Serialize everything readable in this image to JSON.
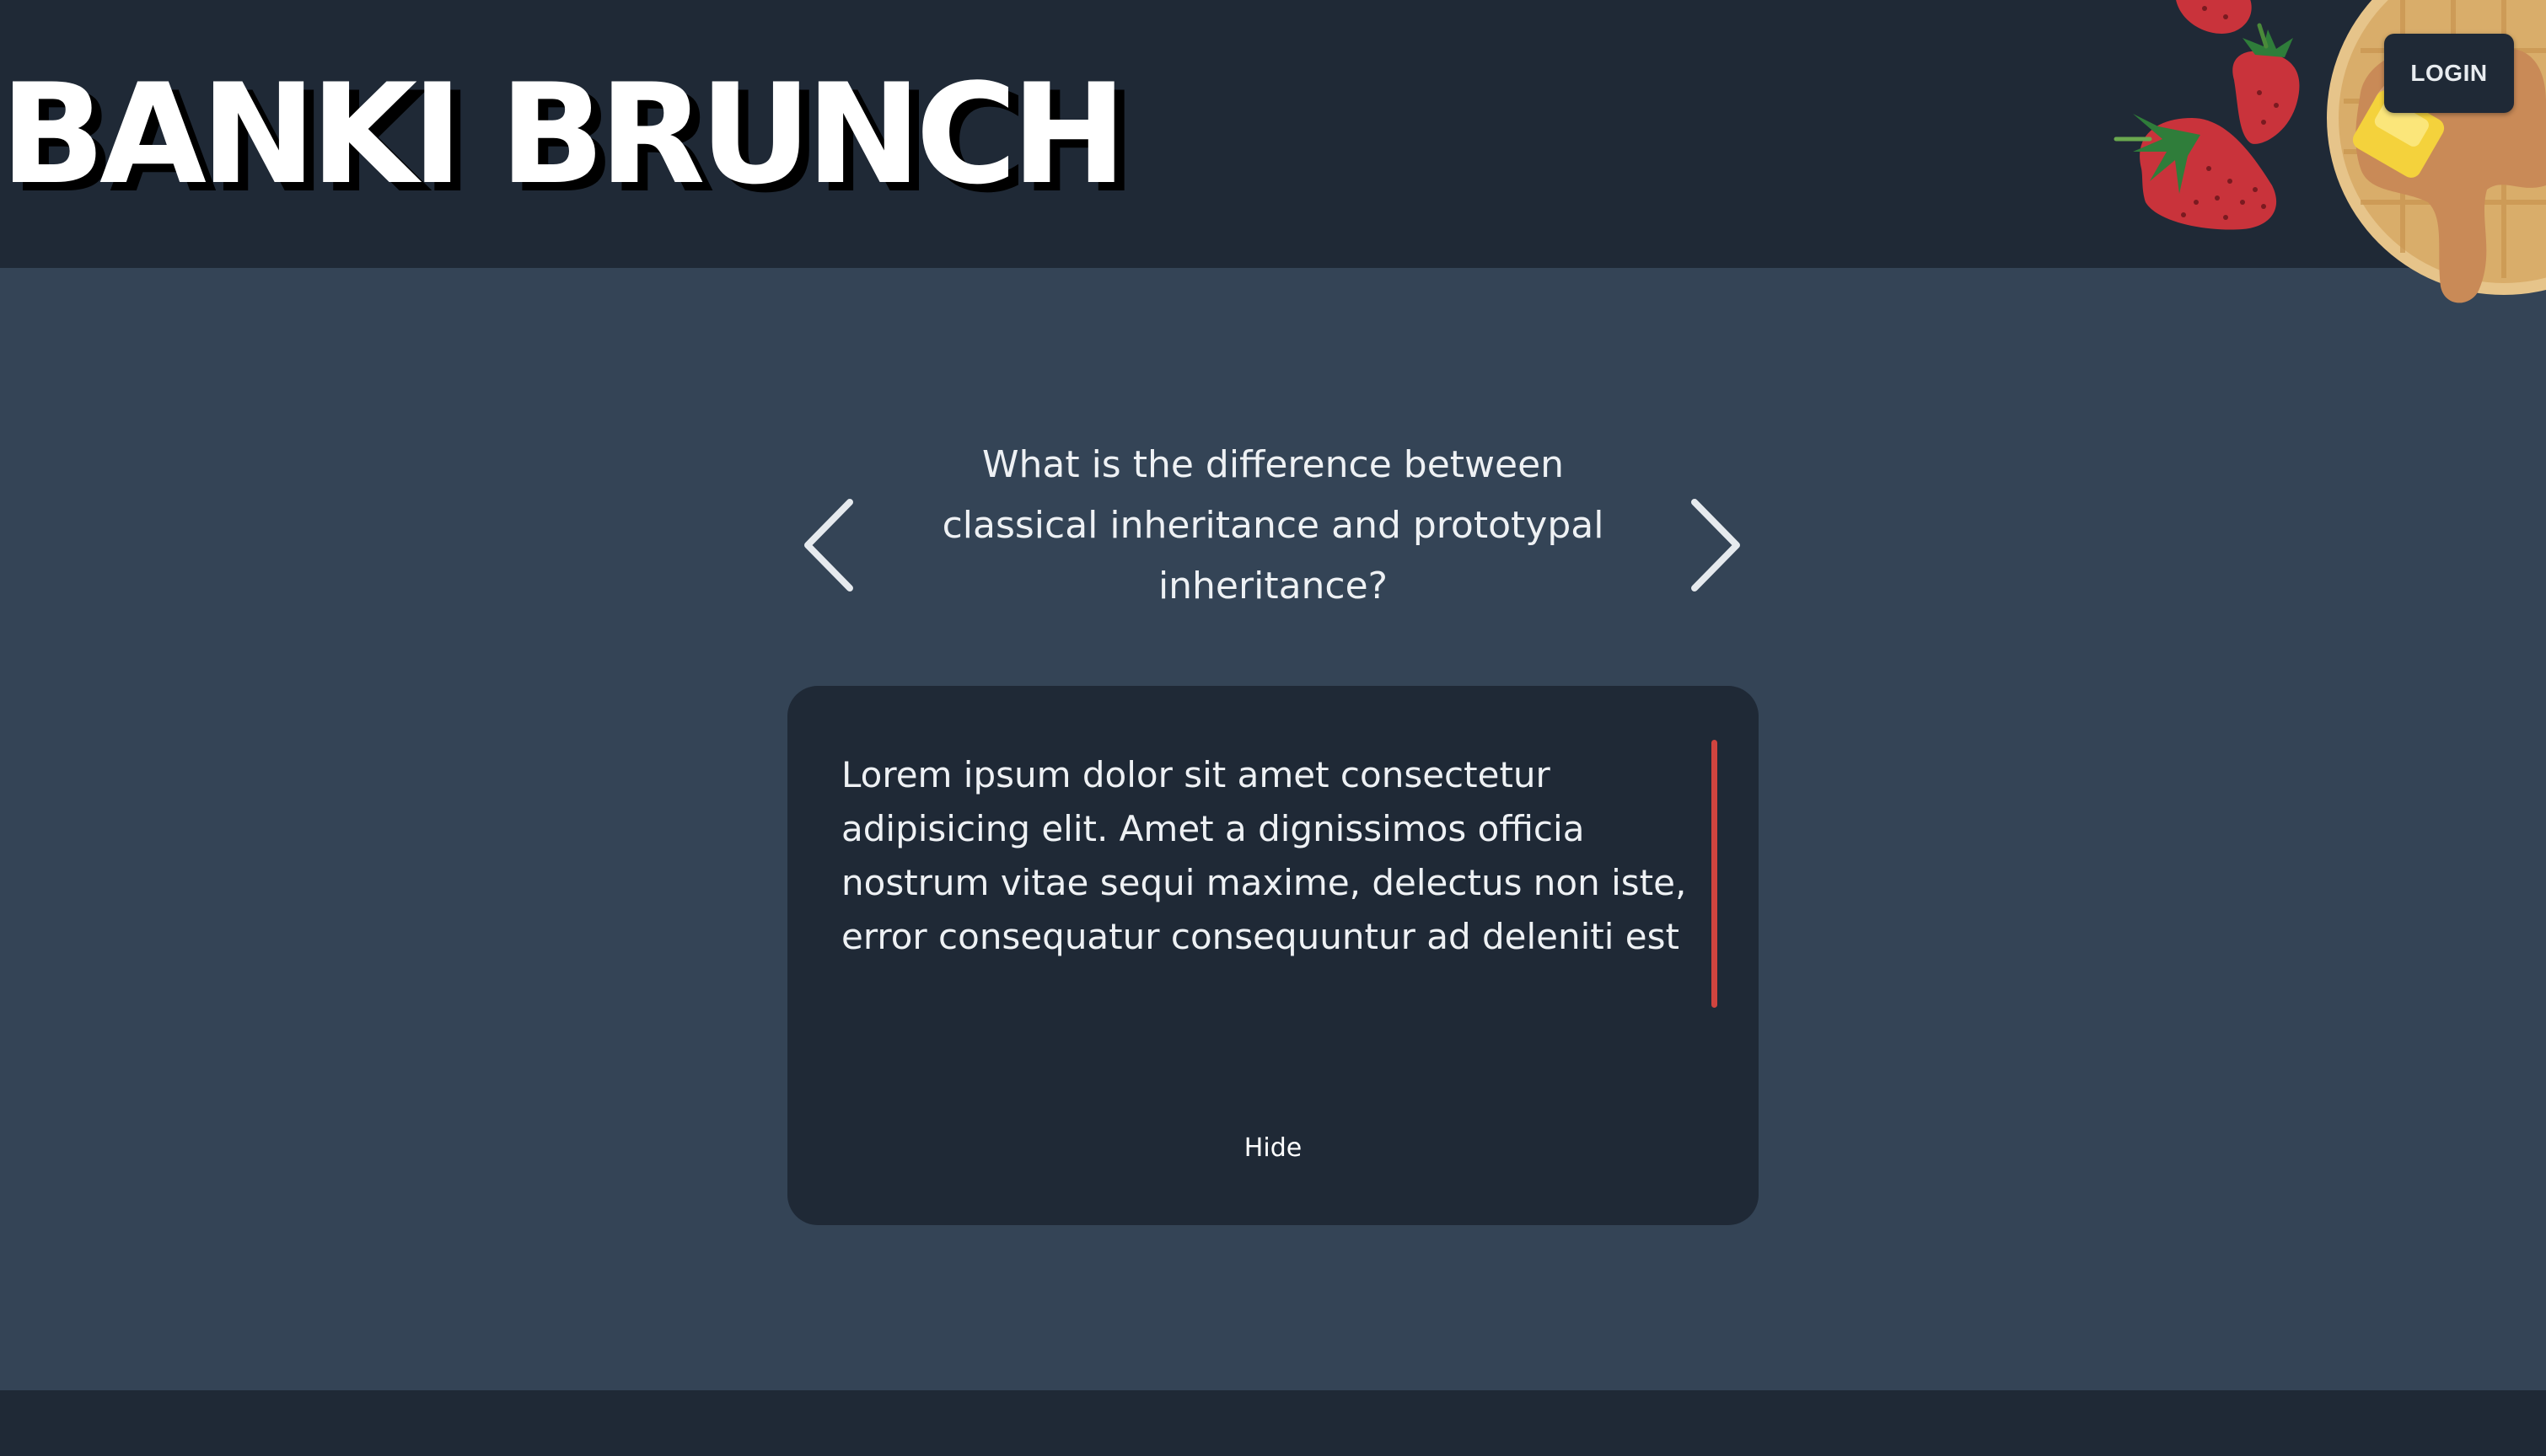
{
  "header": {
    "brand_title": "BANKI BRUNCH",
    "login_label": "LOGIN",
    "decoration": "strawberry-waffle-illustration"
  },
  "carousel": {
    "question": "What is the difference between classical inheritance and prototypal inheritance?",
    "prev_icon": "chevron-left-icon",
    "next_icon": "chevron-right-icon"
  },
  "answer_card": {
    "answer_text": "Lorem ipsum dolor sit amet consectetur adipisicing elit. Amet a dignissimos officia nostrum vitae sequi maxime, delectus non iste, error consequatur consequuntur ad deleniti est aspernatur vero laborum tenetur fugiat!Lorem ipsum dolor sit amet consectetur adipisicing elit. Amet a dignissimos officia nostrum vitae",
    "hide_label": "Hide"
  },
  "colors": {
    "header_bg": "#1f2936",
    "page_bg": "#344456",
    "card_bg": "#1f2936",
    "scroll_thumb": "#d0443f",
    "text": "#eef1f4"
  }
}
